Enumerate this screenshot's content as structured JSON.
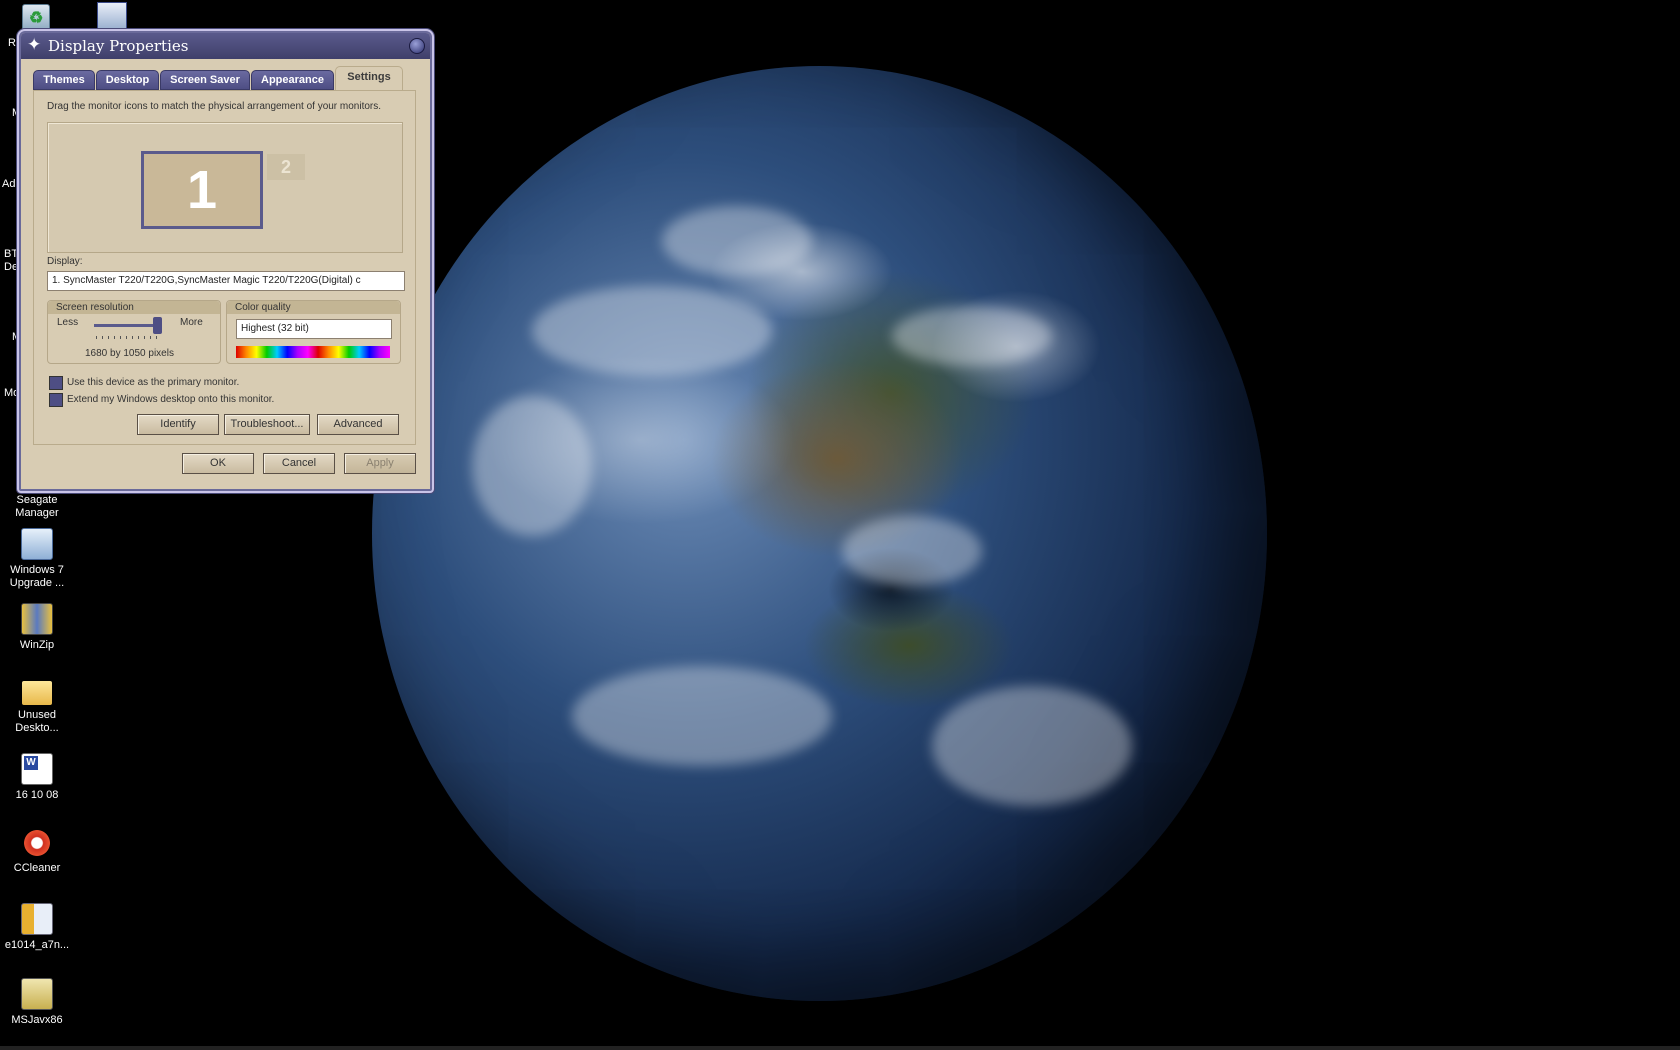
{
  "desktop": {
    "icons": [
      {
        "label": "Seagate Manager",
        "line1": "Seagate",
        "line2": "Manager",
        "icon": "seagate-icon"
      },
      {
        "label": "Windows 7 Upgrade ...",
        "line1": "Windows 7",
        "line2": "Upgrade ...",
        "icon": "installer-icon"
      },
      {
        "label": "WinZip",
        "line1": "WinZip",
        "line2": "",
        "icon": "winzip-icon"
      },
      {
        "label": "Unused Deskto...",
        "line1": "Unused",
        "line2": "Deskto...",
        "icon": "folder-icon"
      },
      {
        "label": "16 10 08",
        "line1": "16 10 08",
        "line2": "",
        "icon": "word-document-icon"
      },
      {
        "label": "CCleaner",
        "line1": "CCleaner",
        "line2": "",
        "icon": "ccleaner-icon"
      },
      {
        "label": "e1014_a7n...",
        "line1": "e1014_a7n...",
        "line2": "",
        "icon": "zip-archive-icon"
      },
      {
        "label": "MSJavx86",
        "line1": "MSJavx86",
        "line2": "",
        "icon": "installer-package-icon"
      }
    ],
    "partial_labels": [
      "R",
      "M",
      "Ad",
      "BT",
      "De",
      "M",
      "Mo"
    ]
  },
  "dialog": {
    "title": "Display Properties",
    "tabs": [
      "Themes",
      "Desktop",
      "Screen Saver",
      "Appearance",
      "Settings"
    ],
    "active_tab": "Settings",
    "instruction": "Drag the monitor icons to match the physical arrangement of your monitors.",
    "monitors": [
      "1",
      "2"
    ],
    "display_label": "Display:",
    "display_value": "1. SyncMaster T220/T220G,SyncMaster Magic T220/T220G(Digital) c",
    "resolution": {
      "group_title": "Screen resolution",
      "less": "Less",
      "more": "More",
      "value": "1680 by 1050 pixels",
      "slider_level": 1.0
    },
    "color_quality": {
      "group_title": "Color quality",
      "value": "Highest (32 bit)"
    },
    "checkboxes": [
      {
        "label": "Use this device as the primary monitor.",
        "checked": true
      },
      {
        "label": "Extend my Windows desktop onto this monitor.",
        "checked": true
      }
    ],
    "buttons": {
      "identify": "Identify",
      "troubleshoot": "Troubleshoot...",
      "advanced": "Advanced",
      "ok": "OK",
      "cancel": "Cancel",
      "apply": "Apply"
    }
  },
  "colors": {
    "titlebar": "#4a4a7c",
    "dialog_bg": "#d8ccb3",
    "tab_bg": "#5c5c92"
  }
}
